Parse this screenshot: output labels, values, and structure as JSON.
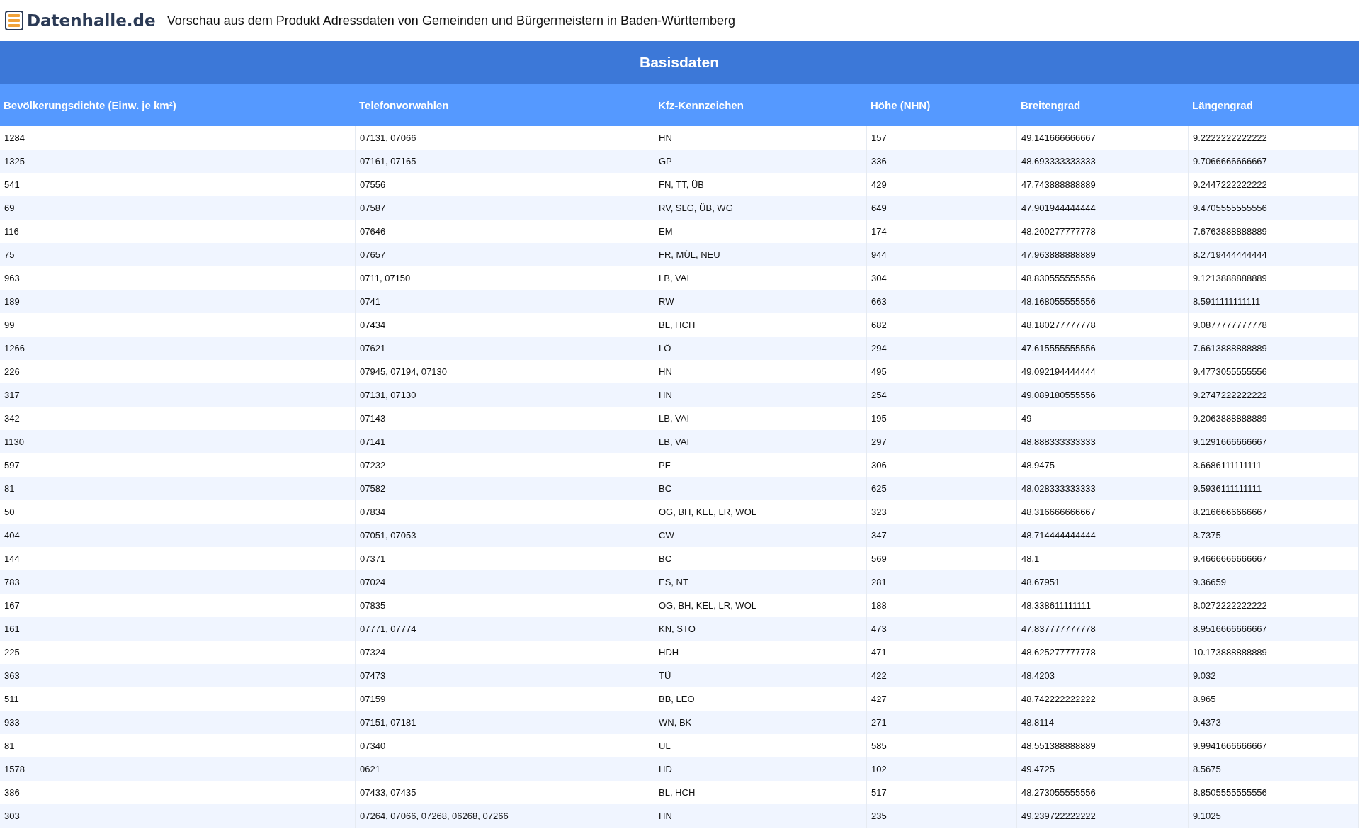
{
  "header": {
    "logo_text": "Datenhalle.de",
    "title": "Vorschau aus dem Produkt Adressdaten von Gemeinden und Bürgermeistern in Baden-Württemberg"
  },
  "section_title": "Basisdaten",
  "table": {
    "columns": [
      "Bevölkerungsdichte (Einw. je km²)",
      "Telefonvorwahlen",
      "Kfz-Kennzeichen",
      "Höhe (NHN)",
      "Breitengrad",
      "Längengrad"
    ],
    "rows": [
      [
        "1284",
        "07131, 07066",
        "HN",
        "157",
        "49.141666666667",
        "9.2222222222222"
      ],
      [
        "1325",
        "07161, 07165",
        "GP",
        "336",
        "48.693333333333",
        "9.7066666666667"
      ],
      [
        "541",
        "07556",
        "FN, TT, ÜB",
        "429",
        "47.743888888889",
        "9.2447222222222"
      ],
      [
        "69",
        "07587",
        "RV, SLG, ÜB, WG",
        "649",
        "47.901944444444",
        "9.4705555555556"
      ],
      [
        "116",
        "07646",
        "EM",
        "174",
        "48.200277777778",
        "7.6763888888889"
      ],
      [
        "75",
        "07657",
        "FR, MÜL, NEU",
        "944",
        "47.963888888889",
        "8.2719444444444"
      ],
      [
        "963",
        "0711, 07150",
        "LB, VAI",
        "304",
        "48.830555555556",
        "9.1213888888889"
      ],
      [
        "189",
        "0741",
        "RW",
        "663",
        "48.168055555556",
        "8.5911111111111"
      ],
      [
        "99",
        "07434",
        "BL, HCH",
        "682",
        "48.180277777778",
        "9.0877777777778"
      ],
      [
        "1266",
        "07621",
        "LÖ",
        "294",
        "47.615555555556",
        "7.6613888888889"
      ],
      [
        "226",
        "07945, 07194, 07130",
        "HN",
        "495",
        "49.092194444444",
        "9.4773055555556"
      ],
      [
        "317",
        "07131, 07130",
        "HN",
        "254",
        "49.089180555556",
        "9.2747222222222"
      ],
      [
        "342",
        "07143",
        "LB, VAI",
        "195",
        "49",
        "9.2063888888889"
      ],
      [
        "1130",
        "07141",
        "LB, VAI",
        "297",
        "48.888333333333",
        "9.1291666666667"
      ],
      [
        "597",
        "07232",
        "PF",
        "306",
        "48.9475",
        "8.6686111111111"
      ],
      [
        "81",
        "07582",
        "BC",
        "625",
        "48.028333333333",
        "9.5936111111111"
      ],
      [
        "50",
        "07834",
        "OG, BH, KEL, LR, WOL",
        "323",
        "48.316666666667",
        "8.2166666666667"
      ],
      [
        "404",
        "07051, 07053",
        "CW",
        "347",
        "48.714444444444",
        "8.7375"
      ],
      [
        "144",
        "07371",
        "BC",
        "569",
        "48.1",
        "9.4666666666667"
      ],
      [
        "783",
        "07024",
        "ES, NT",
        "281",
        "48.67951",
        "9.36659"
      ],
      [
        "167",
        "07835",
        "OG, BH, KEL, LR, WOL",
        "188",
        "48.338611111111",
        "8.0272222222222"
      ],
      [
        "161",
        "07771, 07774",
        "KN, STO",
        "473",
        "47.837777777778",
        "8.9516666666667"
      ],
      [
        "225",
        "07324",
        "HDH",
        "471",
        "48.625277777778",
        "10.173888888889"
      ],
      [
        "363",
        "07473",
        "TÜ",
        "422",
        "48.4203",
        "9.032"
      ],
      [
        "511",
        "07159",
        "BB, LEO",
        "427",
        "48.742222222222",
        "8.965"
      ],
      [
        "933",
        "07151, 07181",
        "WN, BK",
        "271",
        "48.8114",
        "9.4373"
      ],
      [
        "81",
        "07340",
        "UL",
        "585",
        "48.551388888889",
        "9.9941666666667"
      ],
      [
        "1578",
        "0621",
        "HD",
        "102",
        "49.4725",
        "8.5675"
      ],
      [
        "386",
        "07433, 07435",
        "BL, HCH",
        "517",
        "48.273055555556",
        "8.8505555555556"
      ],
      [
        "303",
        "07264, 07066, 07268, 06268, 07266",
        "HN",
        "235",
        "49.239722222222",
        "9.1025"
      ]
    ]
  }
}
